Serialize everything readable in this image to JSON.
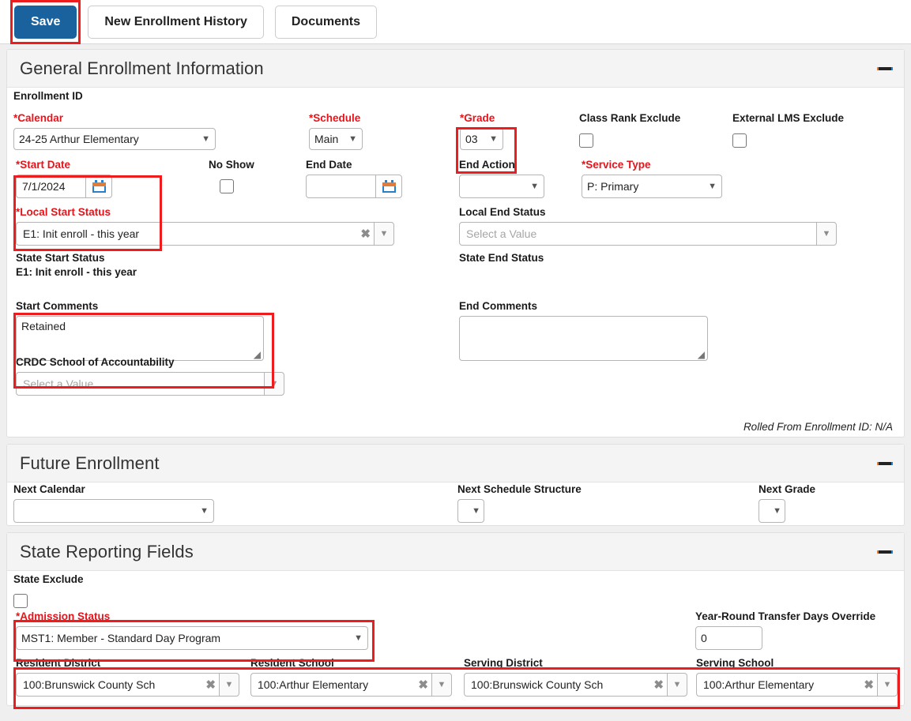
{
  "toolbar": {
    "save_label": "Save",
    "new_enrollment_history_label": "New Enrollment History",
    "documents_label": "Documents"
  },
  "sections": {
    "general": {
      "title": "General Enrollment Information",
      "collapse_icon": "minus-icon",
      "enrollment_id_label": "Enrollment ID",
      "enrollment_id_value": "",
      "calendar_label": "Calendar",
      "calendar_required": "*",
      "calendar_value": "24-25 Arthur Elementary",
      "schedule_label": "Schedule",
      "schedule_required": "*",
      "schedule_value": "Main",
      "grade_label": "Grade",
      "grade_required": "*",
      "grade_value": "03",
      "class_rank_exclude_label": "Class Rank Exclude",
      "class_rank_exclude_checked": false,
      "external_lms_exclude_label": "External LMS Exclude",
      "external_lms_exclude_checked": false,
      "start_date_label": "Start Date",
      "start_date_required": "*",
      "start_date_value": "7/1/2024",
      "no_show_label": "No Show",
      "no_show_checked": false,
      "end_date_label": "End Date",
      "end_date_value": "",
      "end_action_label": "End Action",
      "end_action_value": "",
      "service_type_label": "Service Type",
      "service_type_required": "*",
      "service_type_value": "P: Primary",
      "local_start_status_label": "Local Start Status",
      "local_start_status_required": "*",
      "local_start_status_value": "E1: Init enroll - this year",
      "local_end_status_label": "Local End Status",
      "local_end_status_placeholder": "Select a Value",
      "state_start_status_label": "State Start Status",
      "state_start_status_value": "E1: Init enroll - this year",
      "state_end_status_label": "State End Status",
      "state_end_status_value": "",
      "start_comments_label": "Start Comments",
      "start_comments_value": "Retained",
      "end_comments_label": "End Comments",
      "end_comments_value": "",
      "crdc_label": "CRDC School of Accountability",
      "crdc_placeholder": "Select a Value",
      "rolled_from": "Rolled From Enrollment ID: N/A"
    },
    "future": {
      "title": "Future Enrollment",
      "collapse_icon": "minus-icon",
      "next_calendar_label": "Next Calendar",
      "next_calendar_value": "",
      "next_schedule_structure_label": "Next Schedule Structure",
      "next_schedule_structure_value": "",
      "next_grade_label": "Next Grade",
      "next_grade_value": ""
    },
    "state": {
      "title": "State Reporting Fields",
      "collapse_icon": "minus-icon",
      "state_exclude_label": "State Exclude",
      "state_exclude_checked": false,
      "admission_status_label": "Admission Status",
      "admission_status_required": "*",
      "admission_status_value": "MST1: Member - Standard Day Program",
      "year_round_label": "Year-Round Transfer Days Override",
      "year_round_value": "0",
      "resident_district_label": "Resident District",
      "resident_district_value": "100:Brunswick County Sch",
      "resident_school_label": "Resident School",
      "resident_school_value": "100:Arthur Elementary",
      "serving_district_label": "Serving District",
      "serving_district_value": "100:Brunswick County Sch",
      "serving_school_label": "Serving School",
      "serving_school_value": "100:Arthur Elementary"
    }
  },
  "icons": {
    "caret_down": "▼",
    "clear_x": "✖",
    "resize_grip": "◢"
  },
  "colors": {
    "primary_button": "#19629d",
    "required_label": "#e8131a",
    "highlight_outline": "#ee1c1c",
    "page_background": "#efefef",
    "panel_header": "#f4f4f4"
  }
}
